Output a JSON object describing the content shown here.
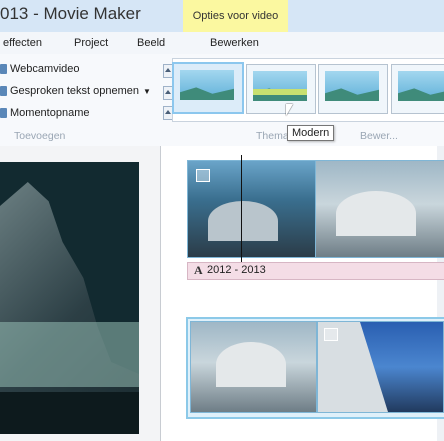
{
  "window": {
    "title": "013 - Movie Maker",
    "context_tab": "Opties voor video"
  },
  "menu": {
    "items": [
      "effecten",
      "Project",
      "Beeld",
      "Bewerken"
    ]
  },
  "ribbon": {
    "items": [
      {
        "label": "Webcamvideo",
        "icon": "webcam-icon"
      },
      {
        "label": "Gesproken tekst opnemen",
        "icon": "microphone-icon",
        "dropdown": true
      },
      {
        "label": "Momentopname",
        "icon": "camera-icon"
      }
    ],
    "group_label": "Toevoegen",
    "gallery_labels": [
      "Thema",
      "Bewer..."
    ],
    "tooltip": "Modern"
  },
  "storyboard": {
    "caption_icon": "A",
    "caption_text": "2012 - 2013"
  },
  "colors": {
    "titlebar": "#d6e6f6",
    "context_tab": "#fbf8a0",
    "caption": "#f4dde6",
    "selection": "#8cc9e8"
  }
}
